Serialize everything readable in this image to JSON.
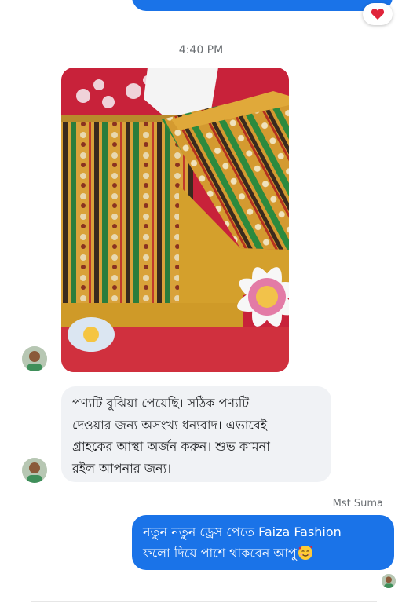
{
  "conversation": {
    "timestamp": "4:40 PM",
    "top_reaction_icon": "heart-icon",
    "incoming_message": {
      "text": "পণ্যটি বুঝিয়া পেয়েছি। সঠিক পণ্যটি\nদেওয়ার জন্য অসংখ্য ধন্যবাদ। এভাবেই\nগ্রাহকের আস্থা অর্জন করুন। শুভ কামনা\nরইল আপনার জন্য।"
    },
    "sender_name": "Mst Suma",
    "outgoing_message": {
      "text": "নতুন নতুন ড্রেস পেতে Faiza Fashion\nফলো দিয়ে পাশে থাকবেন আপু",
      "emoji": "smiling-face-with-hearts-icon"
    }
  },
  "colors": {
    "outgoing_bubble": "#1a73e8",
    "incoming_bubble": "#f0f2f5",
    "reaction_heart": "#e0243a"
  }
}
